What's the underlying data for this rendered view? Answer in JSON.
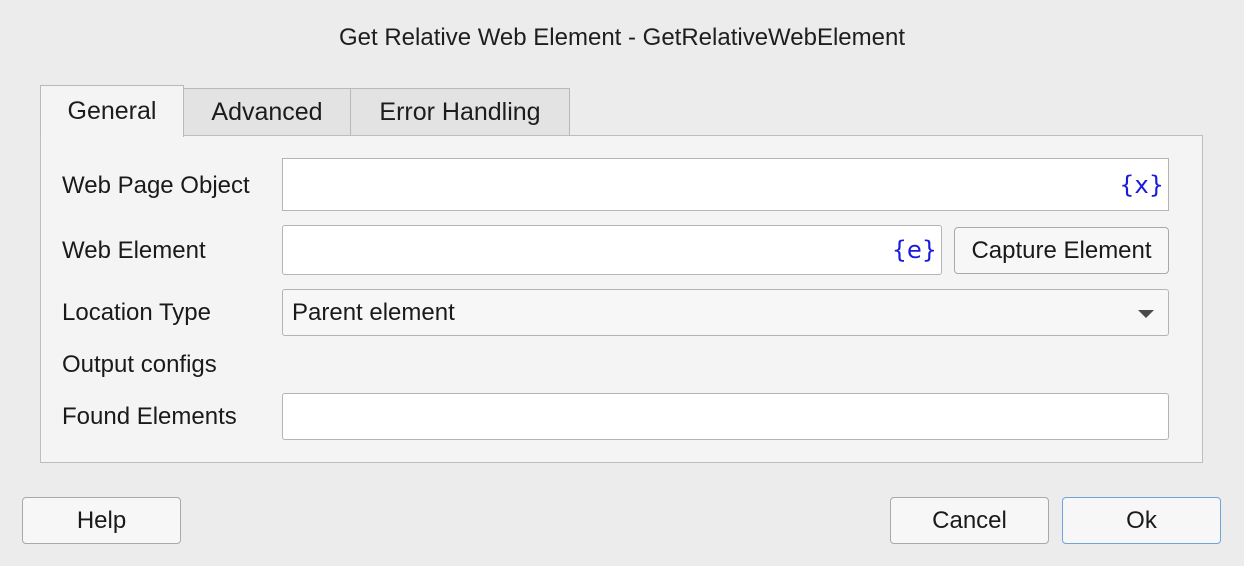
{
  "dialog": {
    "title": "Get Relative Web Element - GetRelativeWebElement"
  },
  "tabs": [
    {
      "label": "General",
      "active": true
    },
    {
      "label": "Advanced",
      "active": false
    },
    {
      "label": "Error Handling",
      "active": false
    }
  ],
  "form": {
    "web_page_object": {
      "label": "Web Page Object",
      "value": "",
      "icon_text": "{x}"
    },
    "web_element": {
      "label": "Web Element",
      "value": "",
      "icon_text": "{e}",
      "capture_label": "Capture Element"
    },
    "location_type": {
      "label": "Location Type",
      "selected": "Parent element"
    },
    "output_configs_label": "Output configs",
    "found_elements": {
      "label": "Found Elements",
      "value": ""
    }
  },
  "footer": {
    "help_label": "Help",
    "cancel_label": "Cancel",
    "ok_label": "Ok"
  },
  "icons": {
    "variable_icon": "curly-brace-x",
    "element_icon": "curly-brace-e",
    "dropdown_icon": "triangle-down"
  },
  "colors": {
    "variable_icon_color": "#1a1adb",
    "primary_button_border": "#6fa3dc",
    "dialog_background": "#ececec"
  }
}
